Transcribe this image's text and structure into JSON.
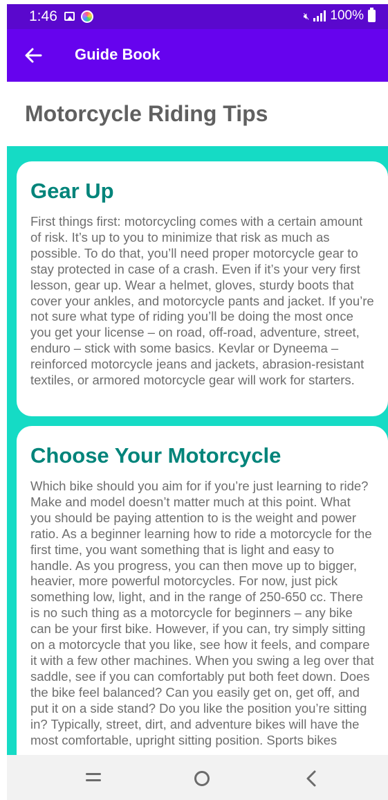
{
  "status_bar": {
    "time": "1:46",
    "battery": "100%",
    "icons": [
      "gallery-icon",
      "app-notification-icon",
      "mute-icon",
      "signal-icon",
      "battery-icon"
    ]
  },
  "app_bar": {
    "title": "Guide Book",
    "back_icon": "arrow-left-icon"
  },
  "page": {
    "title": "Motorcycle Riding Tips"
  },
  "cards": [
    {
      "title": "Gear Up",
      "body": "First things first: motorcycling comes with a certain amount of risk. It’s up to you to minimize that risk as much as possible. To do that, you’ll need proper motorcycle gear to stay protected in case of a crash. Even if it’s your very first lesson, gear up. Wear a helmet, gloves, sturdy boots that cover your ankles, and motorcycle pants and jacket. If you’re not sure what type of riding you’ll be doing the most once you get your license – on road, off-road, adventure, street, enduro – stick with some basics. Kevlar or Dyneema – reinforced motorcycle jeans and jackets, abrasion-resistant textiles, or armored motorcycle gear will work for starters."
    },
    {
      "title": "Choose Your Motorcycle",
      "body": "Which bike should you aim for if you’re just learning to ride? Make and model doesn’t matter much at this point. What you should be paying attention to is the weight and power ratio. As a beginner learning how to ride a motorcycle for the first time, you want something that is light and easy to handle. As you progress, you can then move up to bigger, heavier, more powerful motorcycles. For now, just pick something low, light, and in the range of 250-650 cc. There is no such thing as a motorcycle for beginners – any bike can be your first bike. However, if you can, try simply sitting on a motorcycle that you like, see how it feels, and compare it with a few other machines. When you swing a leg over that saddle, see if you can comfortably put both feet down. Does the bike feel balanced? Can you easily get on, get off, and put it on a side stand? Do you like the position you’re sitting in? Typically, street, dirt, and adventure bikes will have the most comfortable, upright sitting position. Sports bikes"
    }
  ],
  "nav_bar": {
    "icons": [
      "recents-icon",
      "home-icon",
      "back-icon"
    ]
  },
  "colors": {
    "status_bar": "#5a08cd",
    "app_bar": "#6603ee",
    "content_background": "#15dbc5",
    "card_title": "#00847a",
    "card_text": "#6e6e6e",
    "page_title": "#606060",
    "nav_bar": "#f2f2f2"
  }
}
